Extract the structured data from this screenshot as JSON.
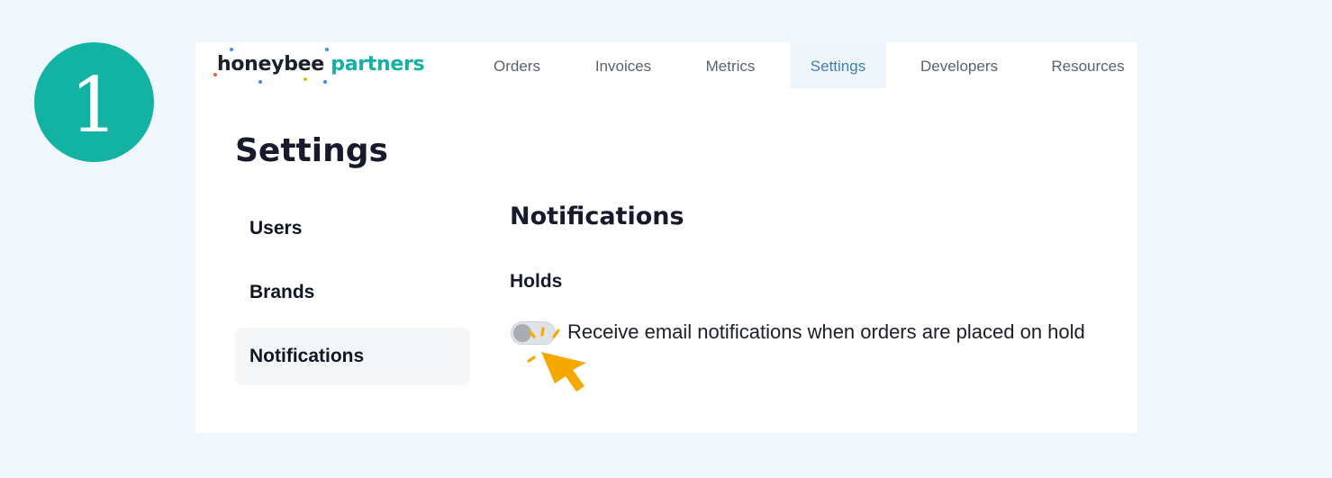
{
  "step": {
    "number": "1"
  },
  "logo": {
    "word1": "honeybee",
    "word2": "partners"
  },
  "nav": {
    "items": [
      {
        "label": "Orders"
      },
      {
        "label": "Invoices"
      },
      {
        "label": "Metrics"
      },
      {
        "label": "Settings",
        "active": true
      },
      {
        "label": "Developers"
      },
      {
        "label": "Resources"
      }
    ]
  },
  "page": {
    "title": "Settings"
  },
  "sidebar": {
    "items": [
      {
        "label": "Users"
      },
      {
        "label": "Brands"
      },
      {
        "label": "Notifications",
        "active": true
      }
    ]
  },
  "main": {
    "section_title": "Notifications",
    "subsection_title": "Holds",
    "toggle": {
      "label": "Receive email notifications when orders are placed on hold",
      "on": false
    }
  },
  "colors": {
    "badge": "#12b3a2",
    "brand_teal": "#15b1a6",
    "cursor": "#f5a800",
    "nav_active": "#3f7fb8"
  },
  "icons": {
    "cursor": "pointer-arrow-click-icon"
  }
}
